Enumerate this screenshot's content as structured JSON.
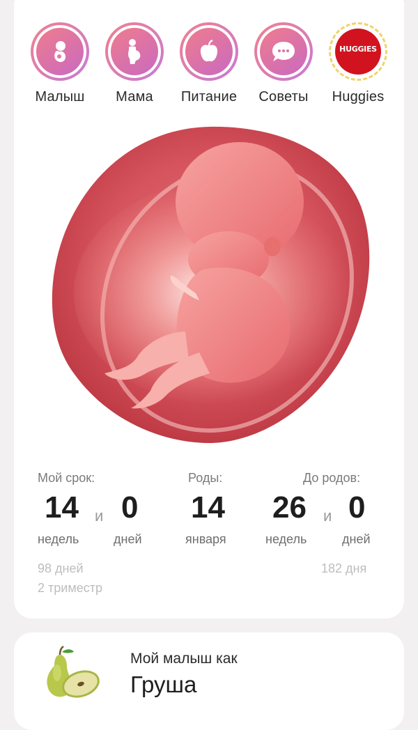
{
  "categories": [
    {
      "label": "Малыш",
      "icon": "fetus-icon"
    },
    {
      "label": "Мама",
      "icon": "pregnant-woman-icon"
    },
    {
      "label": "Питание",
      "icon": "apple-icon"
    },
    {
      "label": "Советы",
      "icon": "chat-bubble-icon"
    },
    {
      "label": "Huggies",
      "icon": "huggies-logo",
      "logo_text": "HUGGIES"
    }
  ],
  "term": {
    "my_term_label": "Мой срок:",
    "weeks": "14",
    "connector": "и",
    "days": "0",
    "weeks_unit": "недель",
    "days_unit": "дней",
    "total_days": "98 дней",
    "trimester": "2 триместр"
  },
  "birth": {
    "label": "Роды:",
    "day": "14",
    "month": "января"
  },
  "until_birth": {
    "label": "До родов:",
    "weeks": "26",
    "connector": "и",
    "days": "0",
    "weeks_unit": "недель",
    "days_unit": "дней",
    "total_days": "182 дня"
  },
  "baby_size": {
    "caption": "Мой малыш как",
    "fruit": "Груша"
  },
  "colors": {
    "accent_ring": "#f0808f",
    "accent_ring_end": "#c77ad5",
    "huggies_red": "#d1131f",
    "huggies_dash": "#f1d36b"
  }
}
